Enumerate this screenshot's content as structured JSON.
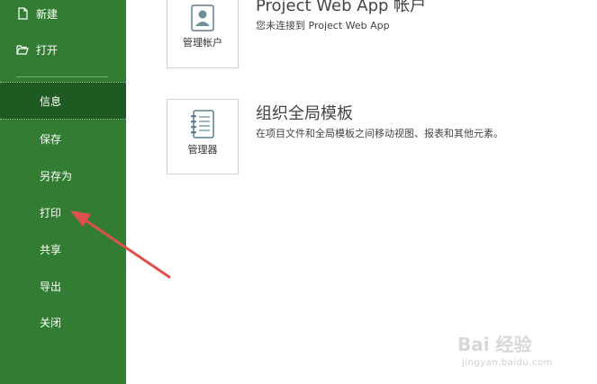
{
  "sidebar": {
    "items": [
      {
        "label": "新建",
        "icon": "new-document-icon"
      },
      {
        "label": "打开",
        "icon": "open-folder-icon"
      },
      {
        "label": "信息"
      },
      {
        "label": "保存"
      },
      {
        "label": "另存为"
      },
      {
        "label": "打印"
      },
      {
        "label": "共享"
      },
      {
        "label": "导出"
      },
      {
        "label": "关闭"
      }
    ],
    "active_index": 2
  },
  "main": {
    "account_tile": {
      "label": "管理帐户",
      "icon": "account-icon"
    },
    "account_section": {
      "title": "Project Web App 帐户",
      "description": "您未连接到 Project Web App"
    },
    "organizer_tile": {
      "label": "管理器",
      "icon": "notebook-icon"
    },
    "organizer_section": {
      "title": "组织全局模板",
      "description": "在项目文件和全局模板之间移动视图、报表和其他元素。"
    }
  },
  "watermark": {
    "text": "Bai 经验",
    "sub": "jingyan.baidu.com"
  },
  "colors": {
    "sidebar": "#327d33",
    "active": "#1f5a22",
    "annotation_arrow": "#e0504a"
  }
}
